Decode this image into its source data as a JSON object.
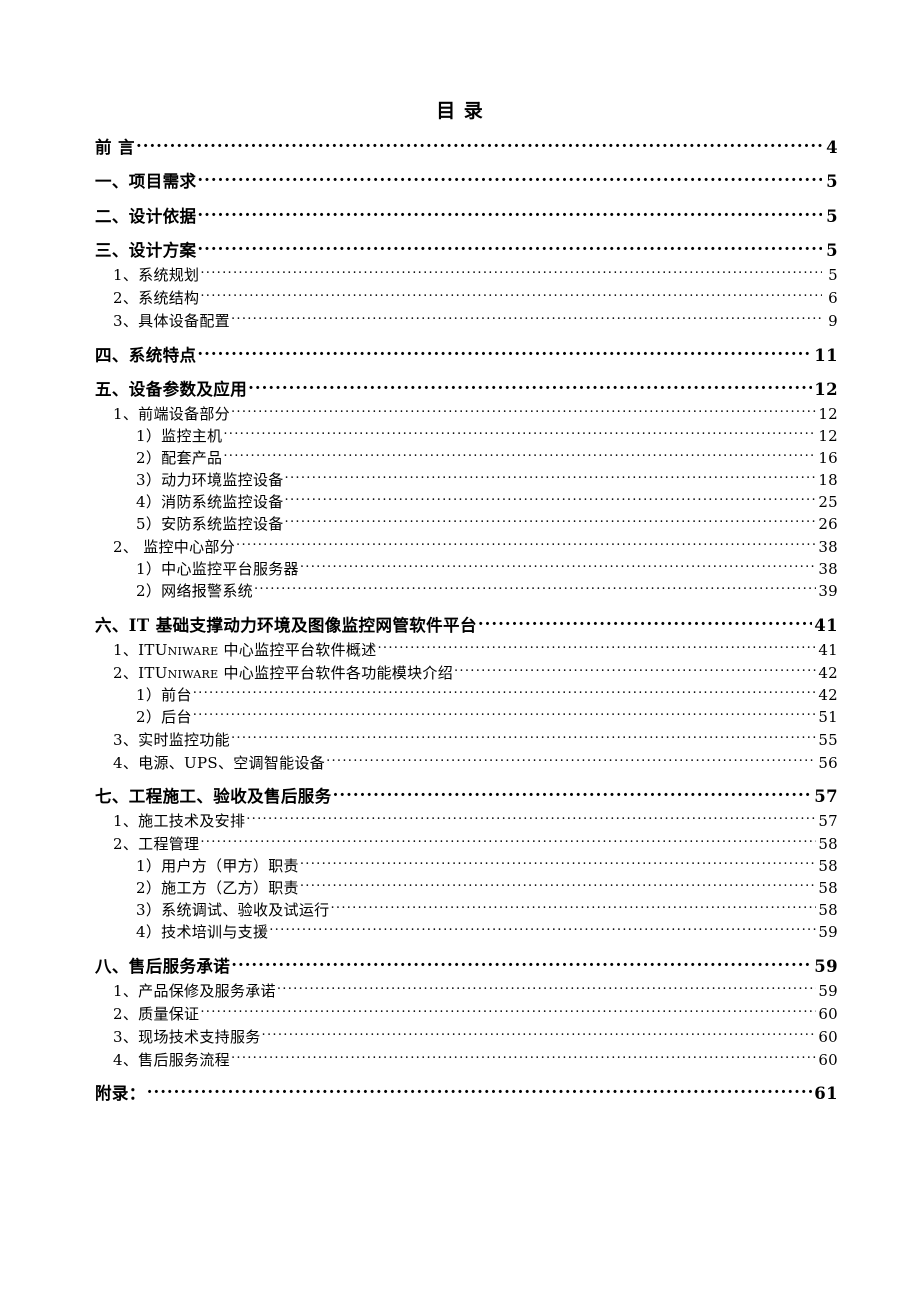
{
  "document": {
    "title": "目    录",
    "title_name": "table-of-contents"
  },
  "toc": {
    "entries": [
      {
        "label": "前  言",
        "page": "4",
        "level": 1,
        "first": true
      },
      {
        "label": "一、项目需求",
        "page": "5",
        "level": 1
      },
      {
        "label": "二、设计依据",
        "page": "5",
        "level": 1
      },
      {
        "label": "三、设计方案",
        "page": "5",
        "level": 1
      },
      {
        "label": "1、系统规划",
        "page": "5",
        "level": 2
      },
      {
        "label": "2、系统结构",
        "page": "6",
        "level": 2
      },
      {
        "label": "3、具体设备配置",
        "page": "9",
        "level": 2
      },
      {
        "label": "四、系统特点",
        "page": "11",
        "level": 1
      },
      {
        "label": "五、设备参数及应用",
        "page": "12",
        "level": 1
      },
      {
        "label": "1、前端设备部分",
        "page": "12",
        "level": 2
      },
      {
        "label": "1）监控主机",
        "page": "12",
        "level": 3
      },
      {
        "label": "2）配套产品",
        "page": "16",
        "level": 3
      },
      {
        "label": "3）动力环境监控设备",
        "page": "18",
        "level": 3
      },
      {
        "label": "4）消防系统监控设备",
        "page": "25",
        "level": 3
      },
      {
        "label": "5）安防系统监控设备",
        "page": "26",
        "level": 3
      },
      {
        "label": "2、 监控中心部分",
        "page": "38",
        "level": 2
      },
      {
        "label": "1）中心监控平台服务器",
        "page": "38",
        "level": 3
      },
      {
        "label": "2）网络报警系统",
        "page": "39",
        "level": 3
      },
      {
        "label": "六、IT 基础支撑动力环境及图像监控网管软件平台",
        "page": "41",
        "level": 1
      },
      {
        "label": "1、ITUniware 中心监控平台软件概述",
        "page": "41",
        "level": 2
      },
      {
        "label": "2、ITUniware 中心监控平台软件各功能模块介绍",
        "page": "42",
        "level": 2
      },
      {
        "label": "1）前台",
        "page": "42",
        "level": 3
      },
      {
        "label": "2）后台",
        "page": "51",
        "level": 3
      },
      {
        "label": "3、实时监控功能",
        "page": "55",
        "level": 2
      },
      {
        "label": "4、电源、UPS、空调智能设备",
        "page": "56",
        "level": 2
      },
      {
        "label": "七、工程施工、验收及售后服务",
        "page": "57",
        "level": 1
      },
      {
        "label": "1、施工技术及安排",
        "page": "57",
        "level": 2
      },
      {
        "label": "2、工程管理",
        "page": "58",
        "level": 2
      },
      {
        "label": "1）用户方（甲方）职责",
        "page": "58",
        "level": 3
      },
      {
        "label": "2）施工方（乙方）职责",
        "page": "58",
        "level": 3
      },
      {
        "label": "3）系统调试、验收及试运行",
        "page": "58",
        "level": 3
      },
      {
        "label": "4）技术培训与支援",
        "page": "59",
        "level": 3
      },
      {
        "label": "八、售后服务承诺",
        "page": "59",
        "level": 1
      },
      {
        "label": "1、产品保修及服务承诺",
        "page": "59",
        "level": 2
      },
      {
        "label": "2、质量保证",
        "page": "60",
        "level": 2
      },
      {
        "label": "3、现场技术支持服务",
        "page": "60",
        "level": 2
      },
      {
        "label": "4、售后服务流程",
        "page": "60",
        "level": 2
      },
      {
        "label": "附录：",
        "page": "61",
        "level": 1
      }
    ]
  },
  "colors": {
    "text": "#000000",
    "background": "#ffffff"
  }
}
